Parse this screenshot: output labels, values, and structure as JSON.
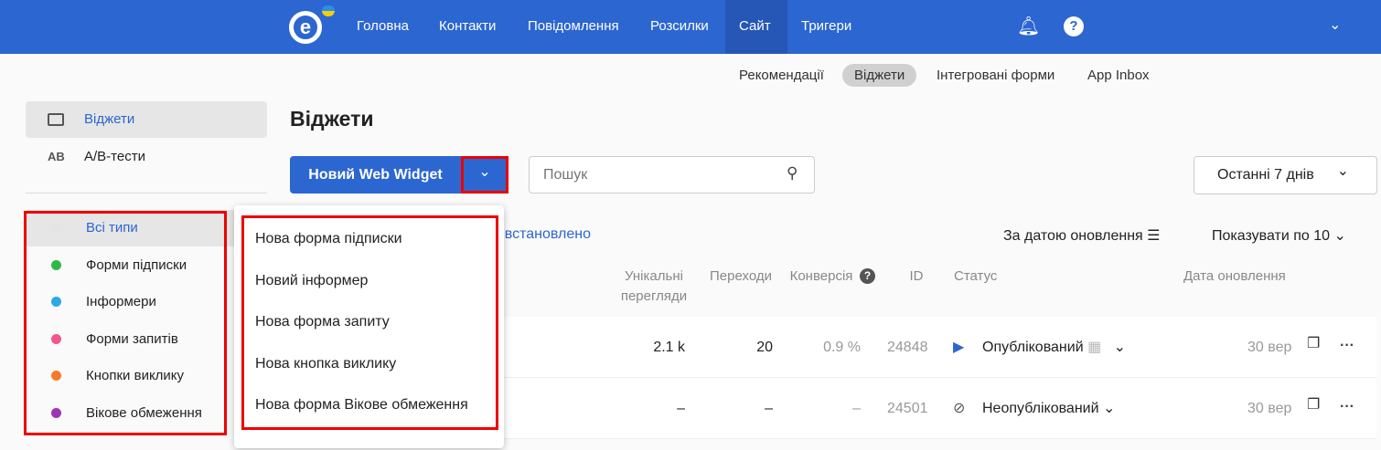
{
  "header": {
    "nav": [
      "Головна",
      "Контакти",
      "Повідомлення",
      "Розсилки",
      "Сайт",
      "Тригери"
    ],
    "active": "Сайт"
  },
  "subtabs": [
    "Рекомендації",
    "Віджети",
    "Інтегровані форми",
    "App Inbox"
  ],
  "sidebar": {
    "items": [
      {
        "label": "Віджети",
        "icon": "widget-icon"
      },
      {
        "label": "А/В-тести",
        "icon": "AB"
      }
    ],
    "types": [
      {
        "label": "Всі типи",
        "color": "#e4e4e4"
      },
      {
        "label": "Форми підписки",
        "color": "#2fb84a"
      },
      {
        "label": "Інформери",
        "color": "#2ea8e8"
      },
      {
        "label": "Форми запитів",
        "color": "#f2568b"
      },
      {
        "label": "Кнопки виклику",
        "color": "#f47b2a"
      },
      {
        "label": "Вікове обмеження",
        "color": "#9b35b6"
      }
    ]
  },
  "main": {
    "title": "Віджети",
    "new_button": "Новий Web Widget",
    "search_placeholder": "Пошук",
    "date_range": "Останні 7 днів",
    "filter_link": "т встановлено",
    "sort": "За датою оновлення",
    "page_size": "Показувати по 10"
  },
  "dropdown": [
    "Нова форма підписки",
    "Новий інформер",
    "Нова форма запиту",
    "Нова кнопка виклику",
    "Нова форма Вікове обмеження"
  ],
  "table": {
    "headers": [
      "Унікальні перегляди",
      "Переходи",
      "Конверсія",
      "ID",
      "Статус",
      "Дата оновлення"
    ],
    "rows": [
      {
        "views": "2.1 k",
        "clicks": "20",
        "conv": "0.9 %",
        "id": "24848",
        "status": "Опублікований",
        "date": "30 вер"
      },
      {
        "views": "–",
        "clicks": "–",
        "conv": "–",
        "id": "24501",
        "status": "Неопублікований",
        "date": "30 вер"
      }
    ]
  }
}
